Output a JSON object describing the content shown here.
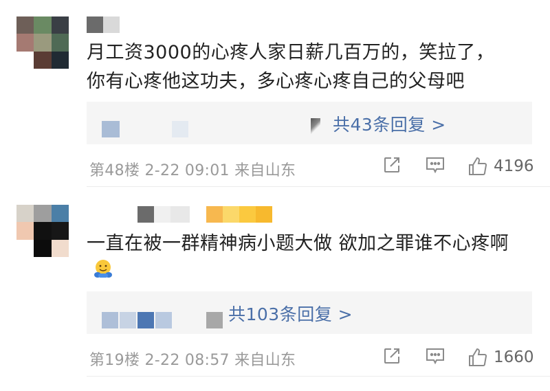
{
  "colors": {
    "link": "#4a6fa8",
    "meta": "#9a9a9a",
    "text": "#222222",
    "reply_bg": "#f5f5f5"
  },
  "comments": [
    {
      "content_line1": "月工资3000的心疼人家日薪几百万的，笑拉了，",
      "content_line2": "你有心疼他这功夫，多心疼心疼自己的父母吧",
      "reply_link": "共43条回复 >",
      "meta": "第48楼 2-22 09:01 来自山东",
      "likes": "4196",
      "icons": [
        "share-icon",
        "comment-icon",
        "thumbs-up-icon"
      ]
    },
    {
      "content_line1": "一直在被一群精神病小题大做 欲加之罪谁不心疼啊",
      "emoji": "hugging-emoji",
      "reply_link": "共103条回复 >",
      "meta": "第19楼 2-22 08:57 来自山东",
      "likes": "1660",
      "icons": [
        "share-icon",
        "comment-icon",
        "thumbs-up-icon"
      ]
    }
  ]
}
